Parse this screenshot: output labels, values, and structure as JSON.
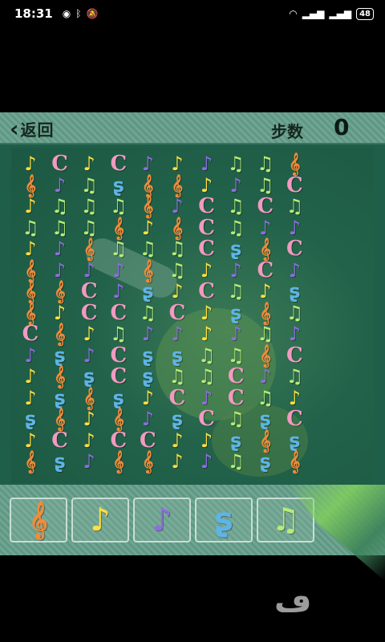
{
  "status_bar": {
    "time": "18:31",
    "battery": "48",
    "left_icons": [
      "eye-icon",
      "bluetooth-icon",
      "mute-icon"
    ],
    "right_icons": [
      "wifi-icon",
      "signal-icon",
      "signal-icon"
    ]
  },
  "header": {
    "back_label": "返回",
    "steps_label": "步数",
    "steps_value": "0"
  },
  "colors": {
    "pink": "#f29ac0",
    "yellow": "#ffe040",
    "purple": "#8f6ee0",
    "blue": "#5fb4e6",
    "green": "#b6ec78",
    "orange": "#f08c3a"
  },
  "tiles": {
    "T": {
      "glyph": "𝄞",
      "color": "orange",
      "name": "treble-clef"
    },
    "Y": {
      "glyph": "♪",
      "color": "yellow",
      "name": "yellow-note"
    },
    "P": {
      "glyph": "♪",
      "color": "purple",
      "name": "purple-note"
    },
    "G": {
      "glyph": "♫",
      "color": "green",
      "name": "green-note"
    },
    "B": {
      "glyph": "ʂ",
      "color": "blue",
      "name": "blue-rest"
    },
    "C": {
      "glyph": "C",
      "color": "pink",
      "name": "pink-c-clef"
    }
  },
  "board": [
    "YCYCPYPGGT",
    "TPGBTTYPGC",
    "YGGGTPCGCG",
    "GGGTYTCGPP",
    "YPTGGGCBTC",
    "TPPPTGYPCP",
    "TTCPBYCGYB",
    "TYCCGCYBTG",
    "CTYGPPYPGP",
    "PBPCBBGGTC",
    "YTBCBGGCPG",
    "YBTBYCPCGY",
    "BTYTPBCGBC",
    "YCYCCYYBTB",
    "TBPTTYPGBT"
  ],
  "tray": [
    "T",
    "Y",
    "P",
    "B",
    "G"
  ]
}
